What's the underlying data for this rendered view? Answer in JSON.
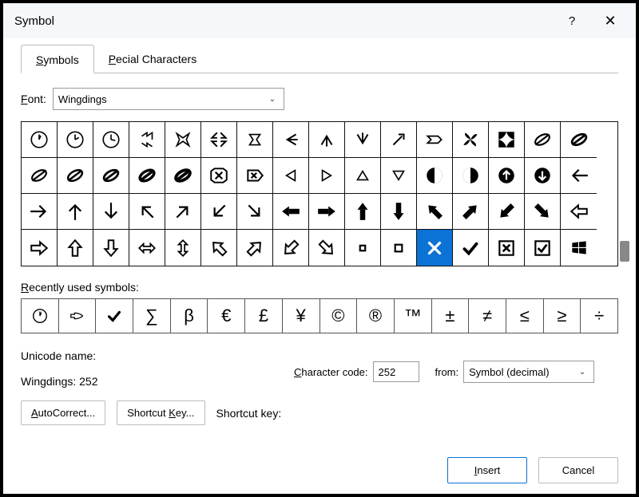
{
  "title": "Symbol",
  "tabs": {
    "symbols": "Symbols",
    "special": "Special Characters"
  },
  "font": {
    "label": "Font:",
    "value": "Wingdings"
  },
  "grid": [
    [
      "clock1",
      "clock2",
      "clock3",
      "dblarrow1",
      "dblarrow2",
      "dblarrow3",
      "dblarrow4",
      "tail-left",
      "tail-up",
      "tail-down",
      "tail-diag",
      "ribbon-right",
      "pinwheel",
      "square-star",
      "leaf-diag1",
      "leaf-diag2"
    ],
    [
      "leaf-oval1",
      "leaf-oval2",
      "leaf-oval3",
      "leaf-bold1",
      "leaf-bold2",
      "x-box",
      "x-tag",
      "caret-left",
      "caret-right",
      "caret-up",
      "caret-down",
      "half-circle-left",
      "half-circle-right",
      "arrow-circle-up",
      "arrow-circle-down",
      "arrow-thin-left"
    ],
    [
      "arrow-thin-right",
      "arrow-thin-up",
      "arrow-thin-down",
      "arrow-thin-ul",
      "arrow-thin-ur",
      "arrow-thin-dl",
      "arrow-thin-dr",
      "arrow-bold-left",
      "arrow-bold-right",
      "arrow-bold-up",
      "arrow-bold-down",
      "arrow-bold-ul",
      "arrow-bold-ur",
      "arrow-bold-dl",
      "arrow-bold-dr",
      "arrow-outline-left"
    ],
    [
      "arrow-outline-right",
      "arrow-outline-up",
      "arrow-outline-down",
      "arrow-outline-lr",
      "arrow-outline-ud",
      "arrow-outline-ul",
      "arrow-outline-ur",
      "arrow-outline-dl",
      "arrow-outline-dr",
      "square-small-1",
      "square-small-2",
      "x-mark",
      "check-mark",
      "x-boxed",
      "check-boxed",
      "windows-logo"
    ]
  ],
  "selected": {
    "row": 3,
    "col": 11
  },
  "recent_label": "Recently used symbols:",
  "recent": [
    "🕐",
    "☞",
    "✓",
    "∑",
    "β",
    "€",
    "£",
    "¥",
    "©",
    "®",
    "™",
    "±",
    "≠",
    "≤",
    "≥",
    "÷"
  ],
  "unicode_name_label": "Unicode name:",
  "wingdings_name": "Wingdings: 252",
  "char_code_label": "Character code:",
  "char_code_value": "252",
  "from_label": "from:",
  "from_value": "Symbol (decimal)",
  "autocorrect_label": "AutoCorrect...",
  "shortcut_key_btn": "Shortcut Key...",
  "shortcut_key_label": "Shortcut key:",
  "insert": "Insert",
  "cancel": "Cancel"
}
